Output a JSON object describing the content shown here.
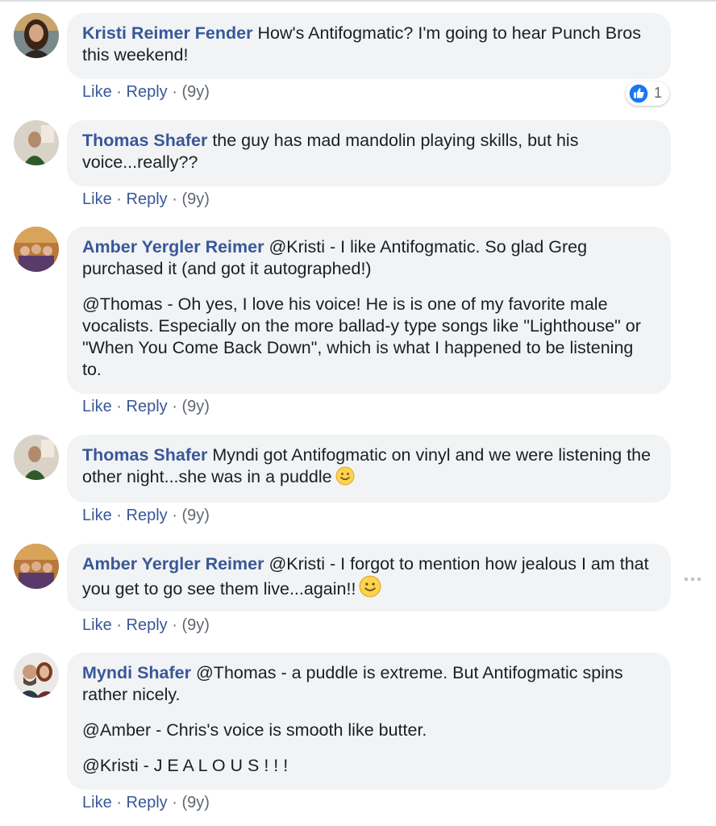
{
  "comments": [
    {
      "author": "Kristi Reimer Fender",
      "paragraphs": [
        "How's Antifogmatic? I'm going to hear Punch Bros this weekend!"
      ],
      "like_label": "Like",
      "reply_label": "Reply",
      "time": "(9y)",
      "reaction": {
        "icon": "thumbs-up-icon",
        "count": "1"
      }
    },
    {
      "author": "Thomas Shafer",
      "paragraphs": [
        "the guy has mad mandolin playing skills, but his voice...really??"
      ],
      "like_label": "Like",
      "reply_label": "Reply",
      "time": "(9y)"
    },
    {
      "author": "Amber Yergler Reimer",
      "paragraphs": [
        "@Kristi - I like Antifogmatic. So glad Greg purchased it (and got it autographed!)",
        "@Thomas - Oh yes, I love his voice! He is is one of my favorite male vocalists. Especially on the more ballad-y type songs like \"Lighthouse\" or \"When You Come Back Down\", which is what I happened to be listening to."
      ],
      "like_label": "Like",
      "reply_label": "Reply",
      "time": "(9y)"
    },
    {
      "author": "Thomas Shafer",
      "paragraphs": [
        "Myndi got Antifogmatic on vinyl and we were listening the other night...she was in a puddle"
      ],
      "emoji": "slightly-smiling-face-icon",
      "like_label": "Like",
      "reply_label": "Reply",
      "time": "(9y)"
    },
    {
      "author": "Amber Yergler Reimer",
      "paragraphs": [
        "@Kristi - I forgot to mention how jealous I am that you get to go see them live...again!!"
      ],
      "emoji": "slightly-smiling-face-icon",
      "like_label": "Like",
      "reply_label": "Reply",
      "time": "(9y)"
    },
    {
      "author": "Myndi Shafer",
      "paragraphs": [
        "@Thomas - a puddle is extreme. But Antifogmatic spins rather nicely.",
        "@Amber - Chris's voice is smooth like butter.",
        "@Kristi - J E A L O U S ! ! !"
      ],
      "like_label": "Like",
      "reply_label": "Reply",
      "time": "(9y)"
    }
  ],
  "separator": "·",
  "more_icon": "more-options-icon",
  "colors": {
    "author_link": "#385898",
    "bubble_bg": "#f2f3f5",
    "like_blue": "#1877f2",
    "meta_gray": "#606770"
  }
}
